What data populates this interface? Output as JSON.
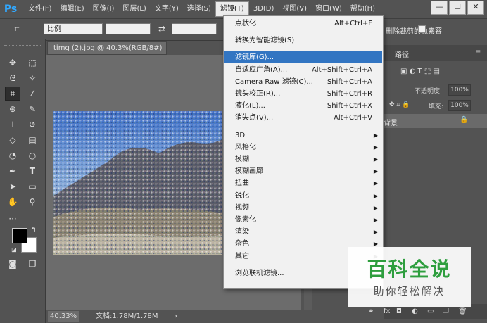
{
  "app": {
    "logo": "Ps"
  },
  "menubar": {
    "items": [
      "文件(F)",
      "编辑(E)",
      "图像(I)",
      "图层(L)",
      "文字(Y)",
      "选择(S)",
      "滤镜(T)",
      "3D(D)",
      "视图(V)",
      "窗口(W)",
      "帮助(H)"
    ],
    "active_index": 6
  },
  "window_controls": [
    "—",
    "☐",
    "✕"
  ],
  "options": {
    "ratio": "比例",
    "right_text": "删除裁剪的像素",
    "content_label": "内容"
  },
  "document": {
    "tab_title": "timg (2).jpg @ 40.3%(RGB/8#) *",
    "tab_close": "×",
    "zoom": "40.33%",
    "doc_info": "文档:1.78M/1.78M",
    "status_arrow": "›"
  },
  "panels": {
    "paths_tab": "路径",
    "opacity_label": "不透明度:",
    "opacity_value": "100%",
    "fill_label": "填充:",
    "fill_value": "100%",
    "layer_name": "背景"
  },
  "filter_menu": {
    "items": [
      {
        "label": "点状化",
        "shortcut": "Alt+Ctrl+F"
      },
      {
        "sep": true
      },
      {
        "label": "转换为智能滤镜(S)"
      },
      {
        "sep": true
      },
      {
        "label": "滤镜库(G)...",
        "highlight": true
      },
      {
        "label": "自适应广角(A)...",
        "shortcut": "Alt+Shift+Ctrl+A"
      },
      {
        "label": "Camera Raw 滤镜(C)...",
        "shortcut": "Shift+Ctrl+A"
      },
      {
        "label": "镜头校正(R)...",
        "shortcut": "Shift+Ctrl+R"
      },
      {
        "label": "液化(L)...",
        "shortcut": "Shift+Ctrl+X"
      },
      {
        "label": "消失点(V)...",
        "shortcut": "Alt+Ctrl+V"
      },
      {
        "sep": true
      },
      {
        "label": "3D",
        "sub": true
      },
      {
        "label": "风格化",
        "sub": true
      },
      {
        "label": "模糊",
        "sub": true
      },
      {
        "label": "模糊画廊",
        "sub": true
      },
      {
        "label": "扭曲",
        "sub": true
      },
      {
        "label": "锐化",
        "sub": true
      },
      {
        "label": "视频",
        "sub": true
      },
      {
        "label": "像素化",
        "sub": true
      },
      {
        "label": "渲染",
        "sub": true
      },
      {
        "label": "杂色",
        "sub": true
      },
      {
        "label": "其它",
        "sub": true
      },
      {
        "sep": true
      },
      {
        "label": "浏览联机滤镜..."
      }
    ]
  },
  "watermark": {
    "title": "百科全说",
    "subtitle": "助你轻松解决"
  },
  "colors": {
    "accent": "#3275c2",
    "watermark_green": "#2e9e3e"
  }
}
